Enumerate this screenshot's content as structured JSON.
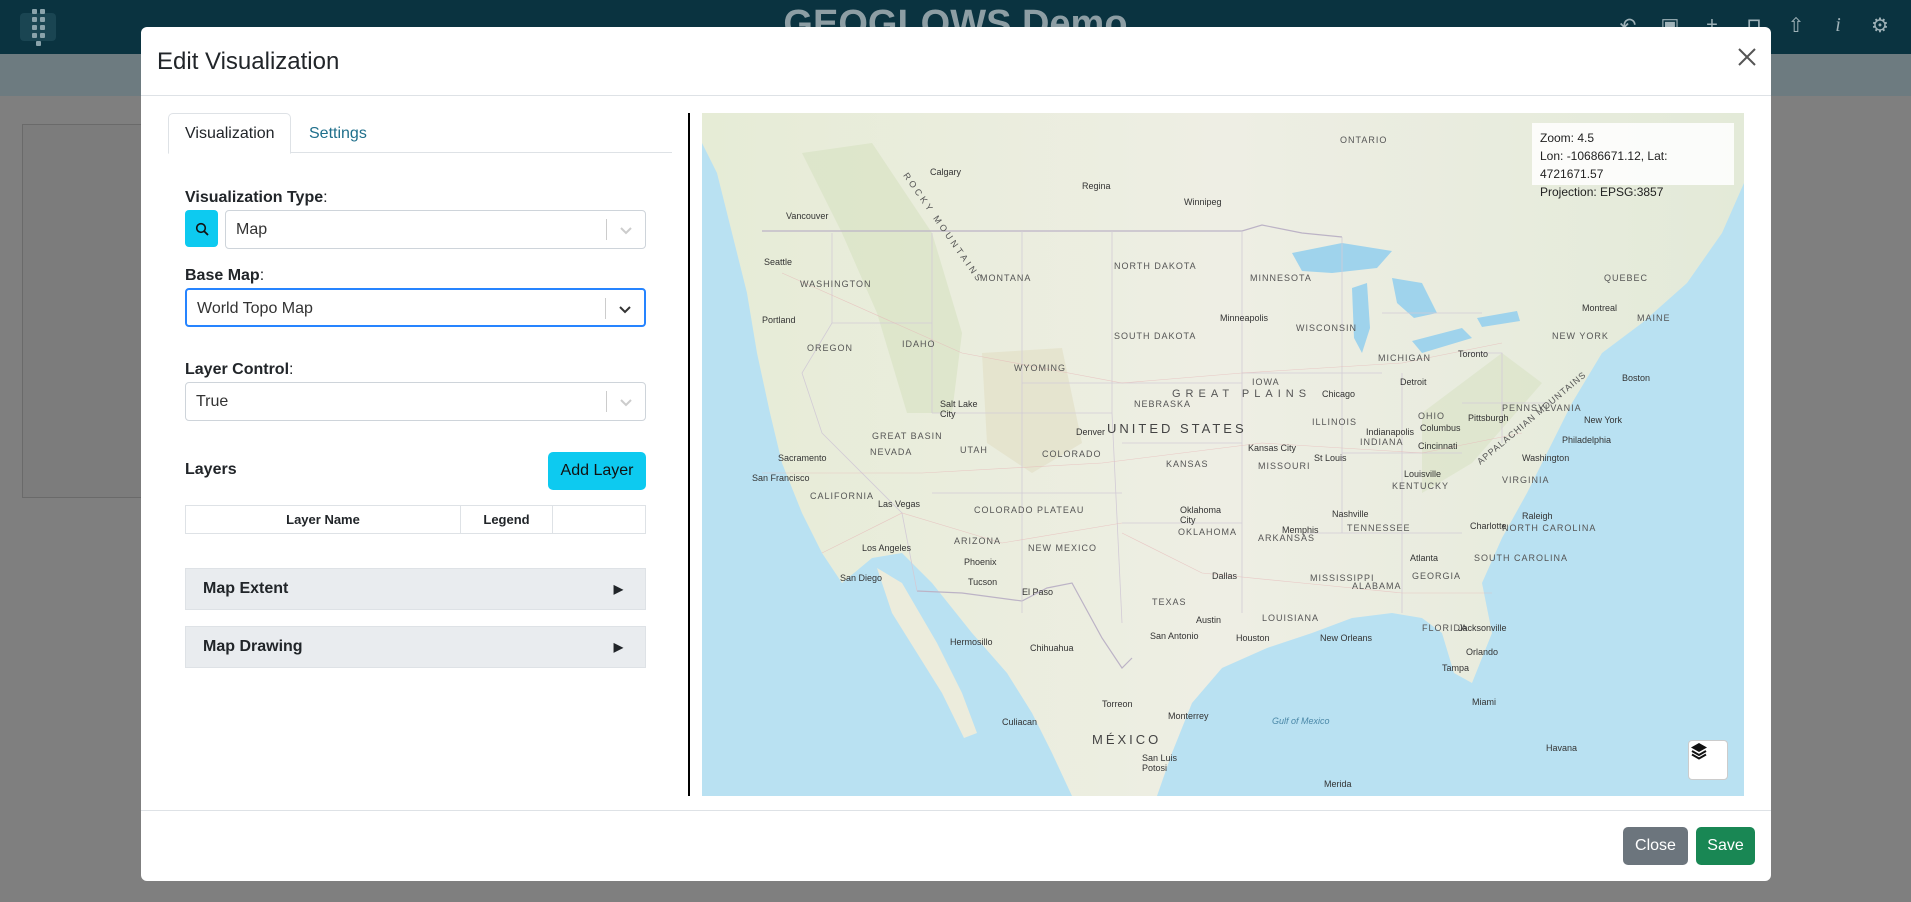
{
  "app": {
    "title": "GEOGLOWS Demo",
    "tools": [
      "undo-icon",
      "save-icon",
      "plus-icon",
      "lock-icon",
      "upload-icon",
      "info-icon",
      "gear-icon"
    ]
  },
  "modal": {
    "title": "Edit Visualization",
    "tabs": [
      {
        "label": "Visualization",
        "active": true
      },
      {
        "label": "Settings",
        "active": false
      }
    ],
    "visualization_type": {
      "label": "Visualization Type",
      "value": "Map"
    },
    "base_map": {
      "label": "Base Map",
      "value": "World Topo Map"
    },
    "layer_control": {
      "label": "Layer Control",
      "value": "True"
    },
    "layers": {
      "title": "Layers",
      "add_button": "Add Layer",
      "columns": [
        "Layer Name",
        "Legend",
        ""
      ]
    },
    "accordions": [
      {
        "title": "Map Extent"
      },
      {
        "title": "Map Drawing"
      }
    ],
    "footer": {
      "close_label": "Close",
      "save_label": "Save"
    }
  },
  "map": {
    "info": {
      "zoom": "Zoom: 4.5",
      "lonlat": "Lon: -10686671.12, Lat: 4721671.57",
      "projection": "Projection: EPSG:3857"
    },
    "labels": {
      "country_us": "UNITED STATES",
      "country_mx": "MÉXICO",
      "great_plains": "GREAT PLAINS",
      "rocky": "ROCKY MOUNTAINS",
      "great_basin": "GREAT BASIN",
      "colorado_plateau": "COLORADO PLATEAU",
      "appalachian": "APPALACHIAN MOUNTAINS",
      "gulf": "Gulf of Mexico",
      "states": [
        "WASHINGTON",
        "OREGON",
        "CALIFORNIA",
        "NEVADA",
        "IDAHO",
        "MONTANA",
        "WYOMING",
        "UTAH",
        "ARIZONA",
        "COLORADO",
        "NEW MEXICO",
        "NORTH DAKOTA",
        "SOUTH DAKOTA",
        "NEBRASKA",
        "KANSAS",
        "OKLAHOMA",
        "TEXAS",
        "MINNESOTA",
        "IOWA",
        "MISSOURI",
        "ARKANSAS",
        "LOUISIANA",
        "WISCONSIN",
        "ILLINOIS",
        "MICHIGAN",
        "INDIANA",
        "OHIO",
        "KENTUCKY",
        "TENNESSEE",
        "MISSISSIPPI",
        "ALABAMA",
        "GEORGIA",
        "FLORIDA",
        "SOUTH CAROLINA",
        "NORTH CAROLINA",
        "VIRGINIA",
        "NEW YORK",
        "PENNSYLVANIA",
        "MAINE",
        "ONTARIO",
        "QUEBEC"
      ],
      "cities": [
        "Calgary",
        "Regina",
        "Winnipeg",
        "Vancouver",
        "Seattle",
        "Portland",
        "Salt Lake City",
        "Denver",
        "Minneapolis",
        "Chicago",
        "Detroit",
        "Toronto",
        "Montreal",
        "Boston",
        "New York",
        "Philadelphia",
        "Washington",
        "Pittsburgh",
        "Kansas City",
        "St Louis",
        "Indianapolis",
        "Columbus",
        "Cincinnati",
        "Louisville",
        "Nashville",
        "Memphis",
        "Atlanta",
        "Charlotte",
        "Raleigh",
        "Oklahoma City",
        "Dallas",
        "Austin",
        "Houston",
        "San Antonio",
        "New Orleans",
        "Jacksonville",
        "Orlando",
        "Tampa",
        "Miami",
        "Las Vegas",
        "Los Angeles",
        "San Diego",
        "San Francisco",
        "Sacramento",
        "Phoenix",
        "Tucson",
        "El Paso",
        "Chihuahua",
        "Monterrey",
        "Hermosillo",
        "Culiacan",
        "San Luis Potosi",
        "Torreon",
        "Havana",
        "Merida"
      ]
    }
  }
}
